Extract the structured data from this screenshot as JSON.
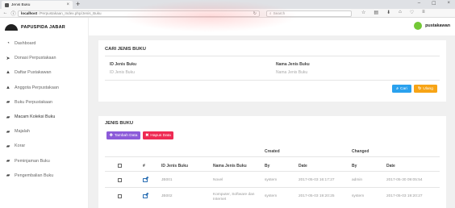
{
  "browser": {
    "tab_title": "Jenis Buku",
    "url_host": "localhost",
    "url_path": "/Perpustakaan_Index.php/Jenis_Buku",
    "search_placeholder": "Search",
    "close_glyph": "×",
    "new_tab_glyph": "+",
    "back_glyph": "←",
    "info_glyph": "ⓘ",
    "reload_glyph": "↻",
    "search_glyph": "⌕",
    "toolbar_glyphs": [
      "☆",
      "▤",
      "⬇",
      "⌂",
      "♡",
      "≡"
    ],
    "window_glyphs": [
      "–",
      "☐",
      "×"
    ]
  },
  "sidebar": {
    "brand": "PAPUSPIDA JABAR",
    "items": [
      {
        "label": "Dashboard",
        "icon": "dashboard-icon",
        "glyph": "◔"
      },
      {
        "label": "Donasi Perpustakaan",
        "icon": "send-icon",
        "glyph": "➤"
      },
      {
        "label": "Daftar Pustakawan",
        "icon": "user-icon",
        "glyph": "▲"
      },
      {
        "label": "Anggota Perpustakaan",
        "icon": "user-icon",
        "glyph": "▲"
      },
      {
        "label": "Buku Perpustakaan",
        "icon": "book-icon",
        "glyph": "▰"
      },
      {
        "label": "Macam Koleksi Buku",
        "icon": "book-icon",
        "glyph": "▰"
      },
      {
        "label": "Majalah",
        "icon": "magazine-icon",
        "glyph": "▰"
      },
      {
        "label": "Korar",
        "icon": "newspaper-icon",
        "glyph": "▰"
      },
      {
        "label": "Peminjaman Buku",
        "icon": "book-icon",
        "glyph": "▰"
      },
      {
        "label": "Pengembalian Buku",
        "icon": "book-icon",
        "glyph": "▰"
      }
    ]
  },
  "header": {
    "user_name": "pustakawan"
  },
  "search_card": {
    "title": "CARI JENIS BUKU",
    "field1_label": "ID Jenis Buku",
    "field1_placeholder": "ID Jenis Buku",
    "field2_label": "Nama Jenis Buku",
    "field2_placeholder": "Nama Jenis Buku",
    "btn_cari": "Cari",
    "btn_ulang": "Ulang",
    "btn_cari_glyph": "⌕",
    "btn_ulang_glyph": "↻"
  },
  "list_card": {
    "title": "JENIS BUKU",
    "btn_tambah": "Tambah Data",
    "btn_hapus": "Hapus Data",
    "btn_tambah_glyph": "✚",
    "btn_hapus_glyph": "✖",
    "header_group_created": "Created",
    "header_group_changed": "Changed",
    "columns": [
      "#",
      "ID Jenis Buku",
      "Nama Jenis Buku",
      "By",
      "Date",
      "By",
      "Date"
    ],
    "rows": [
      {
        "id": "JB001",
        "nama": "Novel",
        "created_by": "system",
        "created_date": "2017-05-03 16:17:27",
        "changed_by": "admin",
        "changed_date": "2017-05-30 09:05:54"
      },
      {
        "id": "JB002",
        "nama": "Komputer, Software dan Internet",
        "created_by": "system",
        "created_date": "2017-05-03 19:20:25",
        "changed_by": "system",
        "changed_date": "2017-05-03 19:20:27"
      }
    ]
  },
  "colors": {
    "cari": "#2aa1ee",
    "ulang": "#f7a416",
    "tambah": "#8c5bd9",
    "hapus": "#ee2a53",
    "avatar": "#73c836"
  }
}
